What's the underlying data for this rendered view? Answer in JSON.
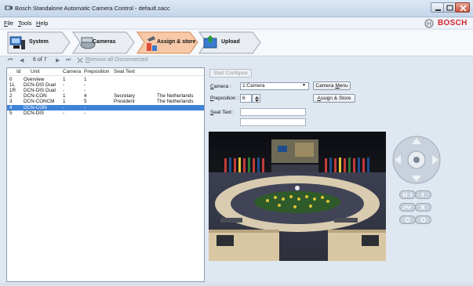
{
  "window": {
    "title": "Bosch Standalone Automatic Camera Control - default.sacc",
    "brand": "BOSCH"
  },
  "menu": [
    {
      "label": "File",
      "underline": "F"
    },
    {
      "label": "Tools",
      "underline": "T"
    },
    {
      "label": "Help",
      "underline": "H"
    }
  ],
  "tabs": [
    {
      "label": "System"
    },
    {
      "label": "Cameras"
    },
    {
      "label": "Assign & store",
      "active": true
    },
    {
      "label": "Upload"
    }
  ],
  "nav": {
    "position_text": "6 of 7",
    "remove_label": "Remove all Disconnected"
  },
  "table": {
    "columns": [
      "Id",
      "Unit",
      "Camera",
      "Preposition",
      "Seat Text"
    ],
    "rows": [
      {
        "id": "0",
        "unit": "Overview",
        "camera": "1",
        "preposition": "1",
        "seat_text": "",
        "country": ""
      },
      {
        "id": "1L",
        "unit": "DCN-DIS Dual",
        "camera": "-",
        "preposition": "-",
        "seat_text": "",
        "country": ""
      },
      {
        "id": "1R",
        "unit": "DCN-DIS Dual",
        "camera": "-",
        "preposition": "-",
        "seat_text": "",
        "country": ""
      },
      {
        "id": "2",
        "unit": "DCN-CON",
        "camera": "1",
        "preposition": "4",
        "seat_text": "Secretary",
        "country": "The Netherlands"
      },
      {
        "id": "3",
        "unit": "DCN-CONCM",
        "camera": "1",
        "preposition": "5",
        "seat_text": "President",
        "country": "The Netherlands"
      },
      {
        "id": "4",
        "unit": "DCN-CON",
        "camera": "-",
        "preposition": "-",
        "seat_text": "",
        "country": "",
        "selected": true
      },
      {
        "id": "5",
        "unit": "DCN-DIS",
        "camera": "-",
        "preposition": "-",
        "seat_text": "",
        "country": ""
      }
    ]
  },
  "form": {
    "start_configure": "Start Configure",
    "camera_label": "Camera :",
    "camera_value": "1:Camera",
    "camera_menu": "Camera Menu",
    "preposition_label": "Preposition :",
    "preposition_value": "6",
    "assign_store": "Assign & Store",
    "seat_text_label": "Seat Text :",
    "seat_text_value_1": "",
    "seat_text_value_2": ""
  },
  "colors": {
    "accent_selection": "#3f83d8",
    "brand_red": "#d3262e",
    "active_tab": "#f7c9a8"
  },
  "icons": [
    "app-icon",
    "first-page-icon",
    "prev-page-icon",
    "next-page-icon",
    "last-page-icon",
    "remove-icon",
    "bosch-logo-icon",
    "system-icon",
    "cameras-icon",
    "assign-store-icon",
    "upload-icon",
    "ptz-joystick-icon",
    "iris-icon",
    "focus-icon",
    "zoom-icon"
  ]
}
